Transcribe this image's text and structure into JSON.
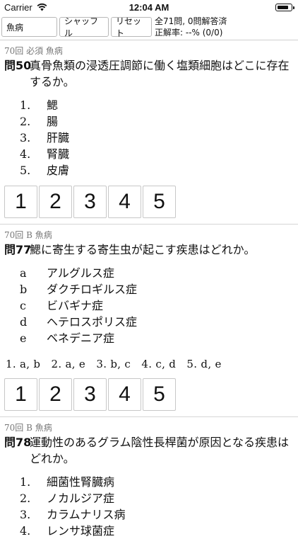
{
  "status": {
    "carrier": "Carrier",
    "time": "12:04 AM"
  },
  "toolbar": {
    "category": "魚病",
    "shuffle": "シャッフル",
    "reset": "リセット",
    "info_line1": "全71問, 0問解答済",
    "info_line2": "正解率: --% (0/0)"
  },
  "questions": [
    {
      "meta": "70回 必須 魚病",
      "number": "問50",
      "text": "真骨魚類の浸透圧調節に働く塩類細胞はどこに存在するか。",
      "choices": [
        {
          "mark": "1.",
          "text": "鰓"
        },
        {
          "mark": "2.",
          "text": "腸"
        },
        {
          "mark": "3.",
          "text": "肝臓"
        },
        {
          "mark": "4.",
          "text": "腎臓"
        },
        {
          "mark": "5.",
          "text": "皮膚"
        }
      ],
      "answers_line": "",
      "buttons": [
        "1",
        "2",
        "3",
        "4",
        "5"
      ]
    },
    {
      "meta": "70回 B 魚病",
      "number": "問77",
      "text": "鰓に寄生する寄生虫が起こす疾患はどれか。",
      "choices": [
        {
          "mark": "a",
          "text": "アルグルス症"
        },
        {
          "mark": "b",
          "text": "ダクチロギルス症"
        },
        {
          "mark": "c",
          "text": "ビバギナ症"
        },
        {
          "mark": "d",
          "text": "ヘテロスポリス症"
        },
        {
          "mark": "e",
          "text": "ベネデニア症"
        }
      ],
      "answers_line": "1. a, b　2. a, e　3. b, c　4. c, d　5. d, e",
      "buttons": [
        "1",
        "2",
        "3",
        "4",
        "5"
      ]
    },
    {
      "meta": "70回 B 魚病",
      "number": "問78",
      "text": "運動性のあるグラム陰性長桿菌が原因となる疾患はどれか。",
      "choices": [
        {
          "mark": "1.",
          "text": "細菌性腎臓病"
        },
        {
          "mark": "2.",
          "text": "ノカルジア症"
        },
        {
          "mark": "3.",
          "text": "カラムナリス病"
        },
        {
          "mark": "4.",
          "text": "レンサ球菌症"
        }
      ],
      "answers_line": "",
      "buttons": []
    }
  ]
}
